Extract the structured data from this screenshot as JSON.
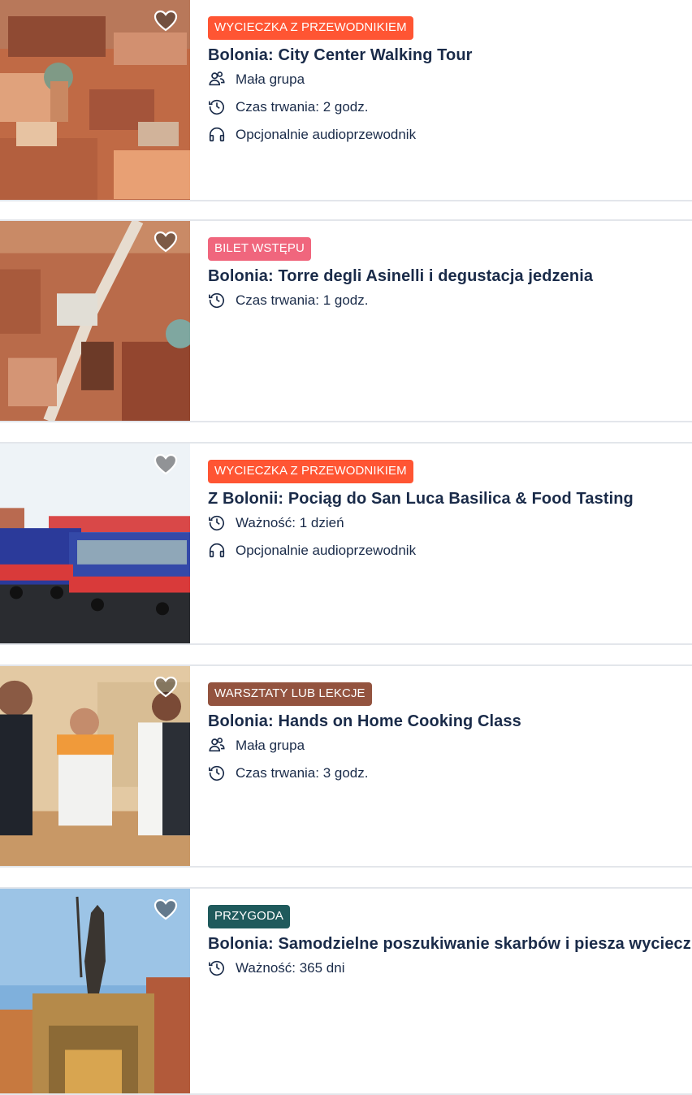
{
  "cards": [
    {
      "category": "WYCIECZKA Z PRZEWODNIKIEM",
      "category_color": "#ff5533",
      "title": "Bolonia: City Center Walking Tour",
      "features": [
        {
          "icon": "group-icon",
          "text": "Mała grupa"
        },
        {
          "icon": "clock-icon",
          "text": "Czas trwania: 2 godz."
        },
        {
          "icon": "headphones-icon",
          "text": "Opcjonalnie audioprzewodnik"
        }
      ]
    },
    {
      "category": "BILET WSTĘPU",
      "category_color": "#f0667d",
      "title": "Bolonia: Torre degli Asinelli i degustacja jedzenia",
      "features": [
        {
          "icon": "clock-icon",
          "text": "Czas trwania: 1 godz."
        }
      ]
    },
    {
      "category": "WYCIECZKA Z PRZEWODNIKIEM",
      "category_color": "#ff5533",
      "title": "Z Bolonii: Pociąg do San Luca Basilica & Food Tasting",
      "features": [
        {
          "icon": "clock-icon",
          "text": "Ważność: 1 dzień"
        },
        {
          "icon": "headphones-icon",
          "text": "Opcjonalnie audioprzewodnik"
        }
      ]
    },
    {
      "category": "WARSZTATY LUB LEKCJE",
      "category_color": "#93533f",
      "title": "Bolonia: Hands on Home Cooking Class",
      "features": [
        {
          "icon": "group-icon",
          "text": "Mała grupa"
        },
        {
          "icon": "clock-icon",
          "text": "Czas trwania: 3 godz."
        }
      ]
    },
    {
      "category": "PRZYGODA",
      "category_color": "#1f5a5c",
      "title": "Bolonia: Samodzielne poszukiwanie skarbów i piesza wycieczka",
      "features": [
        {
          "icon": "clock-icon",
          "text": "Ważność: 365 dni"
        }
      ]
    }
  ]
}
